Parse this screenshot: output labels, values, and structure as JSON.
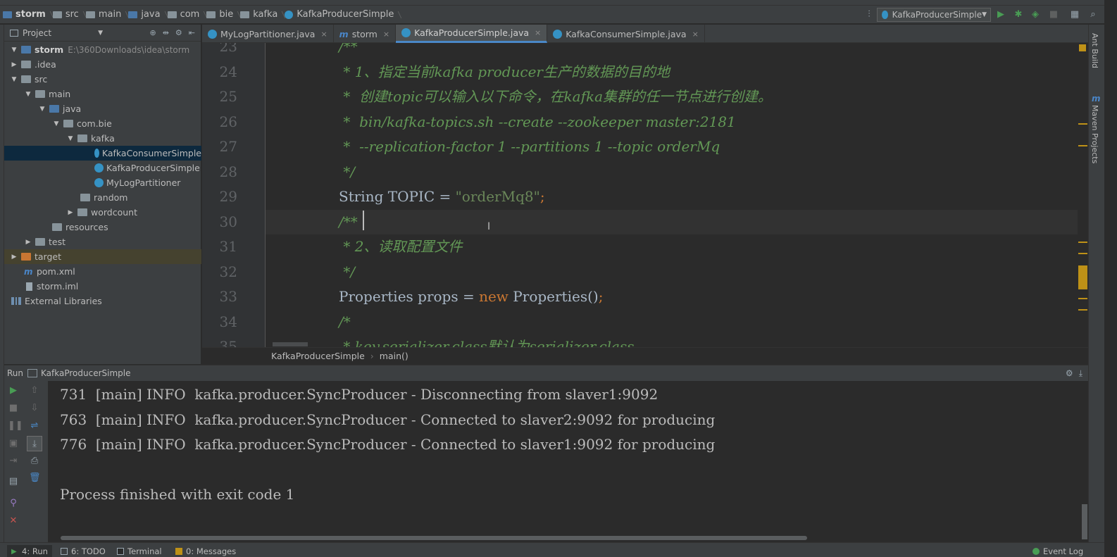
{
  "navbar": {
    "crumbs": [
      "storm",
      "src",
      "main",
      "java",
      "com",
      "bie",
      "kafka",
      "KafkaProducerSimple"
    ],
    "run_config": "KafkaProducerSimple"
  },
  "project": {
    "header": "Project",
    "tree": [
      {
        "label": "storm",
        "path": "E:\\360Downloads\\idea\\storm"
      },
      {
        "label": ".idea"
      },
      {
        "label": "src"
      },
      {
        "label": "main"
      },
      {
        "label": "java"
      },
      {
        "label": "com.bie"
      },
      {
        "label": "kafka"
      },
      {
        "label": "KafkaConsumerSimple"
      },
      {
        "label": "KafkaProducerSimple"
      },
      {
        "label": "MyLogPartitioner"
      },
      {
        "label": "random"
      },
      {
        "label": "wordcount"
      },
      {
        "label": "resources"
      },
      {
        "label": "test"
      },
      {
        "label": "target"
      },
      {
        "label": "pom.xml"
      },
      {
        "label": "storm.iml"
      },
      {
        "label": "External Libraries"
      }
    ]
  },
  "tabs": [
    {
      "label": "MyLogPartitioner.java"
    },
    {
      "label": "storm"
    },
    {
      "label": "KafkaProducerSimple.java"
    },
    {
      "label": "KafkaConsumerSimple.java"
    }
  ],
  "editor": {
    "lines": [
      {
        "num": "23",
        "text": "/**"
      },
      {
        "num": "24",
        "text": " * 1、指定当前kafka producer生产的数据的目的地"
      },
      {
        "num": "25",
        "text": " *  创建topic可以输入以下命令，在kafka集群的任一节点进行创建。"
      },
      {
        "num": "26",
        "text": " *  bin/kafka-topics.sh --create --zookeeper master:2181"
      },
      {
        "num": "27",
        "text": " *  --replication-factor 1 --partitions 1 --topic orderMq"
      },
      {
        "num": "28",
        "text": " */"
      },
      {
        "num": "29",
        "a": "String TOPIC = ",
        "b": "\"orderMq8\"",
        "c": ";"
      },
      {
        "num": "30",
        "text": "/**"
      },
      {
        "num": "31",
        "text": " * 2、读取配置文件"
      },
      {
        "num": "32",
        "text": " */"
      },
      {
        "num": "33",
        "a": "Properties props = ",
        "kw": "new",
        "b2": " Properties()",
        "c": ";"
      },
      {
        "num": "34",
        "text": "/*"
      },
      {
        "num": "35",
        "text": " * key.serializer.class默认为serializer.class"
      }
    ],
    "breadcrumb": [
      "KafkaProducerSimple",
      "main()"
    ]
  },
  "right_tools": [
    "Ant Build",
    "Maven Projects"
  ],
  "run": {
    "title": "Run",
    "config": "KafkaProducerSimple",
    "console": [
      "731  [main] INFO  kafka.producer.SyncProducer - Disconnecting from slaver1:9092",
      "763  [main] INFO  kafka.producer.SyncProducer - Connected to slaver2:9092 for producing",
      "776  [main] INFO  kafka.producer.SyncProducer - Connected to slaver1:9092 for producing",
      "",
      "Process finished with exit code 1"
    ]
  },
  "bottom": {
    "tabs": [
      "4: Run",
      "6: TODO",
      "Terminal",
      "0: Messages"
    ],
    "event_log": "Event Log"
  },
  "colors": {
    "background": "#2b2b2b",
    "panel": "#3c3f41",
    "comment": "#629755",
    "string": "#6a8759",
    "keyword": "#cc7832",
    "run_green": "#499c54"
  }
}
